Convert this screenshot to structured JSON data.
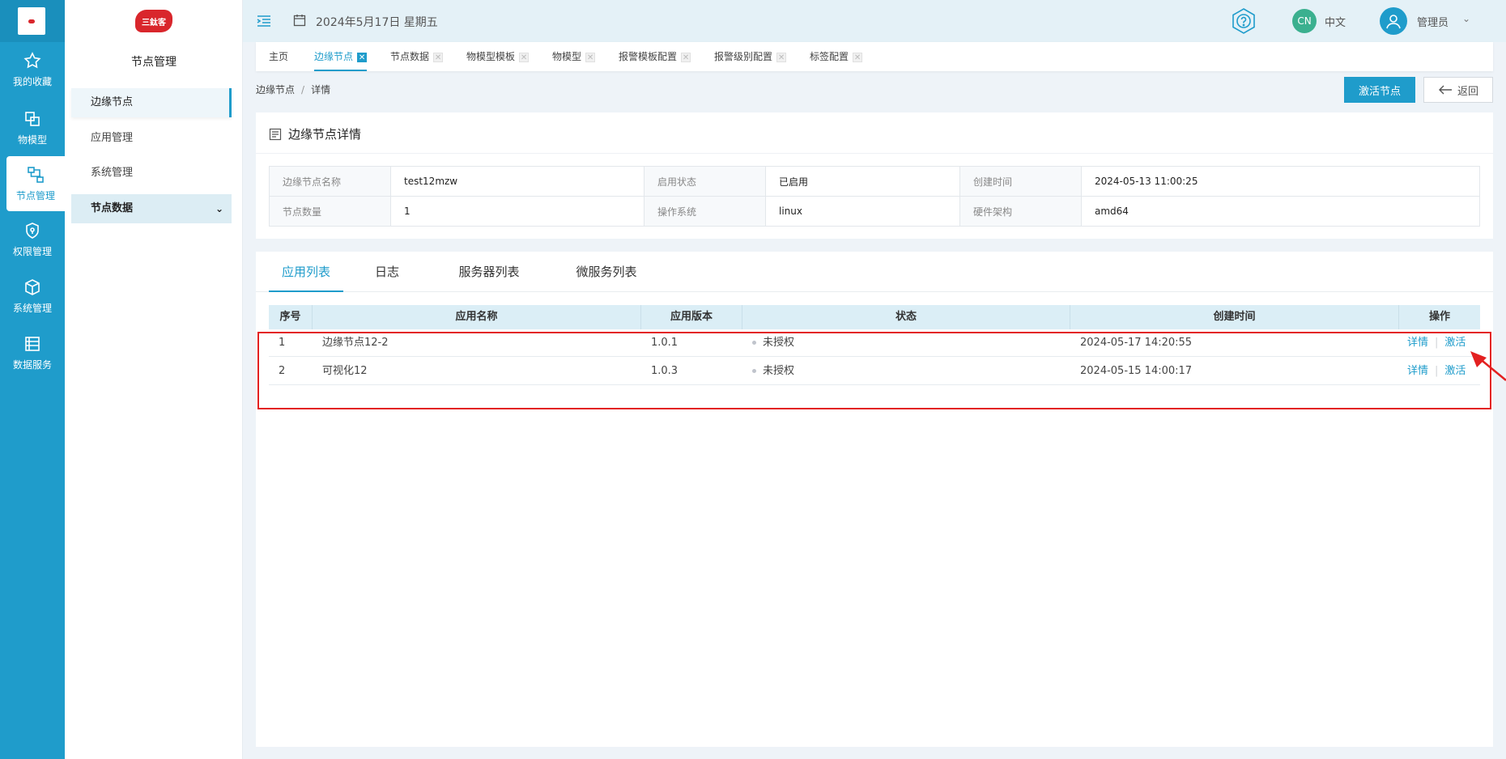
{
  "rail": {
    "items": [
      {
        "label": "我的收藏",
        "icon": "star-icon"
      },
      {
        "label": "物模型",
        "icon": "model-icon"
      },
      {
        "label": "节点管理",
        "icon": "nodes-icon"
      },
      {
        "label": "权限管理",
        "icon": "shield-icon"
      },
      {
        "label": "系统管理",
        "icon": "cube-icon"
      },
      {
        "label": "数据服务",
        "icon": "data-icon"
      }
    ],
    "active_index": 2
  },
  "sidebar": {
    "logo_text": "三鈦客",
    "title": "节点管理",
    "items": [
      {
        "label": "边缘节点"
      },
      {
        "label": "应用管理"
      },
      {
        "label": "系统管理"
      },
      {
        "label": "节点数据"
      }
    ]
  },
  "topbar": {
    "date": "2024年5月17日 星期五",
    "lang_badge": "CN",
    "lang": "中文",
    "user": "管理员"
  },
  "tabs": [
    {
      "label": "主页"
    },
    {
      "label": "边缘节点"
    },
    {
      "label": "节点数据"
    },
    {
      "label": "物模型模板"
    },
    {
      "label": "物模型"
    },
    {
      "label": "报警模板配置"
    },
    {
      "label": "报警级别配置"
    },
    {
      "label": "标签配置"
    }
  ],
  "breadcrumb": {
    "parent": "边缘节点",
    "sep": "/",
    "current": "详情"
  },
  "actions": {
    "activate": "激活节点",
    "back": "返回"
  },
  "detail": {
    "title": "边缘节点详情",
    "rows": [
      [
        {
          "k": "边缘节点名称",
          "v": "test12mzw"
        },
        {
          "k": "启用状态",
          "v": "已启用"
        },
        {
          "k": "创建时间",
          "v": "2024-05-13 11:00:25"
        }
      ],
      [
        {
          "k": "节点数量",
          "v": "1"
        },
        {
          "k": "操作系统",
          "v": "linux"
        },
        {
          "k": "硬件架构",
          "v": "amd64"
        }
      ]
    ]
  },
  "panel_tabs": [
    {
      "label": "应用列表"
    },
    {
      "label": "日志"
    },
    {
      "label": "服务器列表"
    },
    {
      "label": "微服务列表"
    }
  ],
  "app_table": {
    "columns": [
      "序号",
      "应用名称",
      "应用版本",
      "状态",
      "创建时间",
      "操作"
    ],
    "rows": [
      {
        "no": "1",
        "name": "边缘节点12-2",
        "version": "1.0.1",
        "status": "未授权",
        "created": "2024-05-17 14:20:55",
        "op1": "详情",
        "op_sep": "|",
        "op2": "激活"
      },
      {
        "no": "2",
        "name": "可视化12",
        "version": "1.0.3",
        "status": "未授权",
        "created": "2024-05-15 14:00:17",
        "op1": "详情",
        "op_sep": "|",
        "op2": "激活"
      }
    ]
  },
  "colors": {
    "accent": "#1f9ccb",
    "highlight": "#e32020"
  }
}
